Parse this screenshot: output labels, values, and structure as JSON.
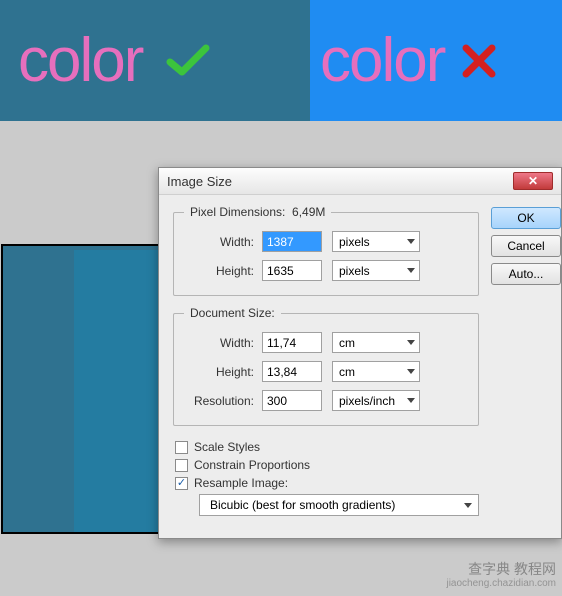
{
  "banner": {
    "left_text": "color",
    "right_text": "color"
  },
  "dialog": {
    "title": "Image Size",
    "buttons": {
      "ok": "OK",
      "cancel": "Cancel",
      "auto": "Auto..."
    },
    "pixel_dimensions": {
      "legend": "Pixel Dimensions:",
      "size": "6,49M",
      "width_label": "Width:",
      "width_value": "1387",
      "width_unit": "pixels",
      "height_label": "Height:",
      "height_value": "1635",
      "height_unit": "pixels"
    },
    "document_size": {
      "legend": "Document Size:",
      "width_label": "Width:",
      "width_value": "11,74",
      "width_unit": "cm",
      "height_label": "Height:",
      "height_value": "13,84",
      "height_unit": "cm",
      "resolution_label": "Resolution:",
      "resolution_value": "300",
      "resolution_unit": "pixels/inch"
    },
    "checks": {
      "scale_styles": "Scale Styles",
      "constrain": "Constrain Proportions",
      "resample": "Resample Image:",
      "resample_method": "Bicubic (best for smooth gradients)"
    }
  },
  "watermark": {
    "line1": "查字典 教程网",
    "line2": "jiaocheng.chazidian.com"
  }
}
